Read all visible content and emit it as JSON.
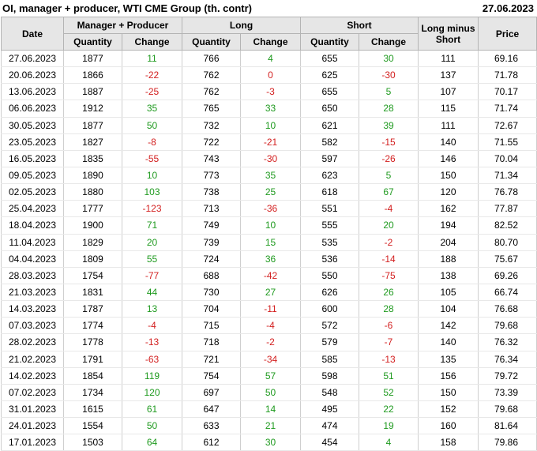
{
  "title": "OI, manager + producer, WTI CME Group (th. contr)",
  "report_date": "27.06.2023",
  "headers": {
    "date": "Date",
    "group1": "Manager + Producer",
    "group2": "Long",
    "group3": "Short",
    "long_minus_short": "Long minus Short",
    "price": "Price",
    "quantity": "Quantity",
    "change": "Change"
  },
  "colors": {
    "positive": "#1f9a1f",
    "negative": "#d32020",
    "header_bg": "#e6e6e6"
  },
  "rows": [
    {
      "date": "27.06.2023",
      "mp_qty": "1877",
      "mp_chg": "11",
      "long_qty": "766",
      "long_chg": "4",
      "short_qty": "655",
      "short_chg": "30",
      "lms": "111",
      "price": "69.16"
    },
    {
      "date": "20.06.2023",
      "mp_qty": "1866",
      "mp_chg": "-22",
      "long_qty": "762",
      "long_chg": "0",
      "short_qty": "625",
      "short_chg": "-30",
      "lms": "137",
      "price": "71.78"
    },
    {
      "date": "13.06.2023",
      "mp_qty": "1887",
      "mp_chg": "-25",
      "long_qty": "762",
      "long_chg": "-3",
      "short_qty": "655",
      "short_chg": "5",
      "lms": "107",
      "price": "70.17"
    },
    {
      "date": "06.06.2023",
      "mp_qty": "1912",
      "mp_chg": "35",
      "long_qty": "765",
      "long_chg": "33",
      "short_qty": "650",
      "short_chg": "28",
      "lms": "115",
      "price": "71.74"
    },
    {
      "date": "30.05.2023",
      "mp_qty": "1877",
      "mp_chg": "50",
      "long_qty": "732",
      "long_chg": "10",
      "short_qty": "621",
      "short_chg": "39",
      "lms": "111",
      "price": "72.67"
    },
    {
      "date": "23.05.2023",
      "mp_qty": "1827",
      "mp_chg": "-8",
      "long_qty": "722",
      "long_chg": "-21",
      "short_qty": "582",
      "short_chg": "-15",
      "lms": "140",
      "price": "71.55"
    },
    {
      "date": "16.05.2023",
      "mp_qty": "1835",
      "mp_chg": "-55",
      "long_qty": "743",
      "long_chg": "-30",
      "short_qty": "597",
      "short_chg": "-26",
      "lms": "146",
      "price": "70.04"
    },
    {
      "date": "09.05.2023",
      "mp_qty": "1890",
      "mp_chg": "10",
      "long_qty": "773",
      "long_chg": "35",
      "short_qty": "623",
      "short_chg": "5",
      "lms": "150",
      "price": "71.34"
    },
    {
      "date": "02.05.2023",
      "mp_qty": "1880",
      "mp_chg": "103",
      "long_qty": "738",
      "long_chg": "25",
      "short_qty": "618",
      "short_chg": "67",
      "lms": "120",
      "price": "76.78"
    },
    {
      "date": "25.04.2023",
      "mp_qty": "1777",
      "mp_chg": "-123",
      "long_qty": "713",
      "long_chg": "-36",
      "short_qty": "551",
      "short_chg": "-4",
      "lms": "162",
      "price": "77.87"
    },
    {
      "date": "18.04.2023",
      "mp_qty": "1900",
      "mp_chg": "71",
      "long_qty": "749",
      "long_chg": "10",
      "short_qty": "555",
      "short_chg": "20",
      "lms": "194",
      "price": "82.52"
    },
    {
      "date": "11.04.2023",
      "mp_qty": "1829",
      "mp_chg": "20",
      "long_qty": "739",
      "long_chg": "15",
      "short_qty": "535",
      "short_chg": "-2",
      "lms": "204",
      "price": "80.70"
    },
    {
      "date": "04.04.2023",
      "mp_qty": "1809",
      "mp_chg": "55",
      "long_qty": "724",
      "long_chg": "36",
      "short_qty": "536",
      "short_chg": "-14",
      "lms": "188",
      "price": "75.67"
    },
    {
      "date": "28.03.2023",
      "mp_qty": "1754",
      "mp_chg": "-77",
      "long_qty": "688",
      "long_chg": "-42",
      "short_qty": "550",
      "short_chg": "-75",
      "lms": "138",
      "price": "69.26"
    },
    {
      "date": "21.03.2023",
      "mp_qty": "1831",
      "mp_chg": "44",
      "long_qty": "730",
      "long_chg": "27",
      "short_qty": "626",
      "short_chg": "26",
      "lms": "105",
      "price": "66.74"
    },
    {
      "date": "14.03.2023",
      "mp_qty": "1787",
      "mp_chg": "13",
      "long_qty": "704",
      "long_chg": "-11",
      "short_qty": "600",
      "short_chg": "28",
      "lms": "104",
      "price": "76.68"
    },
    {
      "date": "07.03.2023",
      "mp_qty": "1774",
      "mp_chg": "-4",
      "long_qty": "715",
      "long_chg": "-4",
      "short_qty": "572",
      "short_chg": "-6",
      "lms": "142",
      "price": "79.68"
    },
    {
      "date": "28.02.2023",
      "mp_qty": "1778",
      "mp_chg": "-13",
      "long_qty": "718",
      "long_chg": "-2",
      "short_qty": "579",
      "short_chg": "-7",
      "lms": "140",
      "price": "76.32"
    },
    {
      "date": "21.02.2023",
      "mp_qty": "1791",
      "mp_chg": "-63",
      "long_qty": "721",
      "long_chg": "-34",
      "short_qty": "585",
      "short_chg": "-13",
      "lms": "135",
      "price": "76.34"
    },
    {
      "date": "14.02.2023",
      "mp_qty": "1854",
      "mp_chg": "119",
      "long_qty": "754",
      "long_chg": "57",
      "short_qty": "598",
      "short_chg": "51",
      "lms": "156",
      "price": "79.72"
    },
    {
      "date": "07.02.2023",
      "mp_qty": "1734",
      "mp_chg": "120",
      "long_qty": "697",
      "long_chg": "50",
      "short_qty": "548",
      "short_chg": "52",
      "lms": "150",
      "price": "73.39"
    },
    {
      "date": "31.01.2023",
      "mp_qty": "1615",
      "mp_chg": "61",
      "long_qty": "647",
      "long_chg": "14",
      "short_qty": "495",
      "short_chg": "22",
      "lms": "152",
      "price": "79.68"
    },
    {
      "date": "24.01.2023",
      "mp_qty": "1554",
      "mp_chg": "50",
      "long_qty": "633",
      "long_chg": "21",
      "short_qty": "474",
      "short_chg": "19",
      "lms": "160",
      "price": "81.64"
    },
    {
      "date": "17.01.2023",
      "mp_qty": "1503",
      "mp_chg": "64",
      "long_qty": "612",
      "long_chg": "30",
      "short_qty": "454",
      "short_chg": "4",
      "lms": "158",
      "price": "79.86"
    }
  ]
}
